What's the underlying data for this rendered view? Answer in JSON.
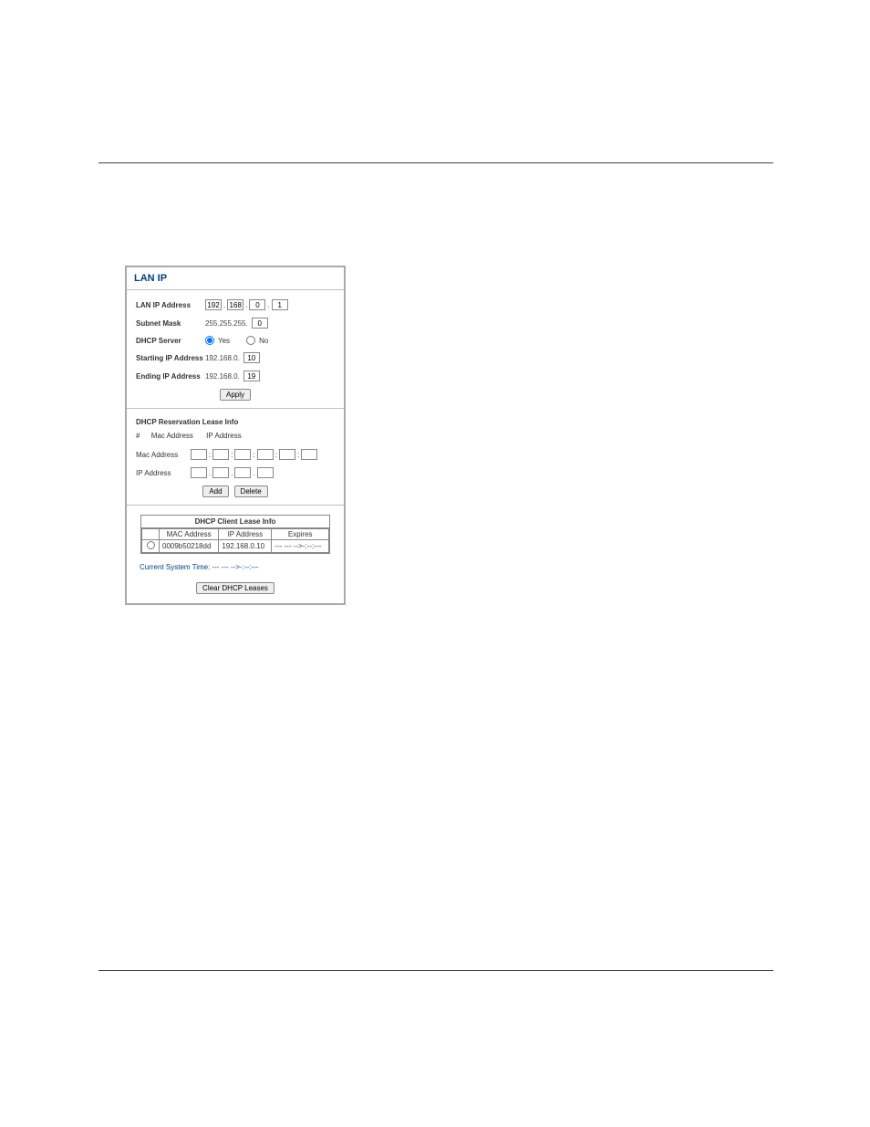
{
  "panel": {
    "title": "LAN IP"
  },
  "lan_ip": {
    "label": "LAN IP Address",
    "octets": [
      "192",
      "168",
      "0",
      "1"
    ]
  },
  "subnet": {
    "label": "Subnet Mask",
    "prefix": "255.255.255.",
    "last_octet": "0"
  },
  "dhcp_server": {
    "label": "DHCP Server",
    "yes": "Yes",
    "no": "No",
    "selected": "yes"
  },
  "starting_ip": {
    "label": "Starting IP Address",
    "prefix": "192.168.0.",
    "last_octet": "10"
  },
  "ending_ip": {
    "label": "Ending IP Address",
    "prefix": "192.168.0.",
    "last_octet": "19"
  },
  "buttons": {
    "apply": "Apply",
    "add": "Add",
    "delete": "Delete",
    "clear_leases": "Clear DHCP Leases"
  },
  "reservation": {
    "heading": "DHCP Reservation Lease Info",
    "col_index": "#",
    "col_mac": "Mac Address",
    "col_ip": "IP Address",
    "mac_label": "Mac Address",
    "ip_label": "IP Address",
    "mac_parts": [
      "",
      "",
      "",
      "",
      "",
      ""
    ],
    "ip_parts": [
      "",
      "",
      "",
      ""
    ]
  },
  "client_lease": {
    "heading": "DHCP Client Lease Info",
    "col_mac": "MAC Address",
    "col_ip": "IP Address",
    "col_expires": "Expires",
    "rows": [
      {
        "mac": "0009b50218dd",
        "ip": "192.168.0.10",
        "expires": "--- --- -->-:--:---"
      }
    ]
  },
  "system_time": {
    "label": "Current System Time:",
    "value": "--- --- -->-:--:---"
  }
}
